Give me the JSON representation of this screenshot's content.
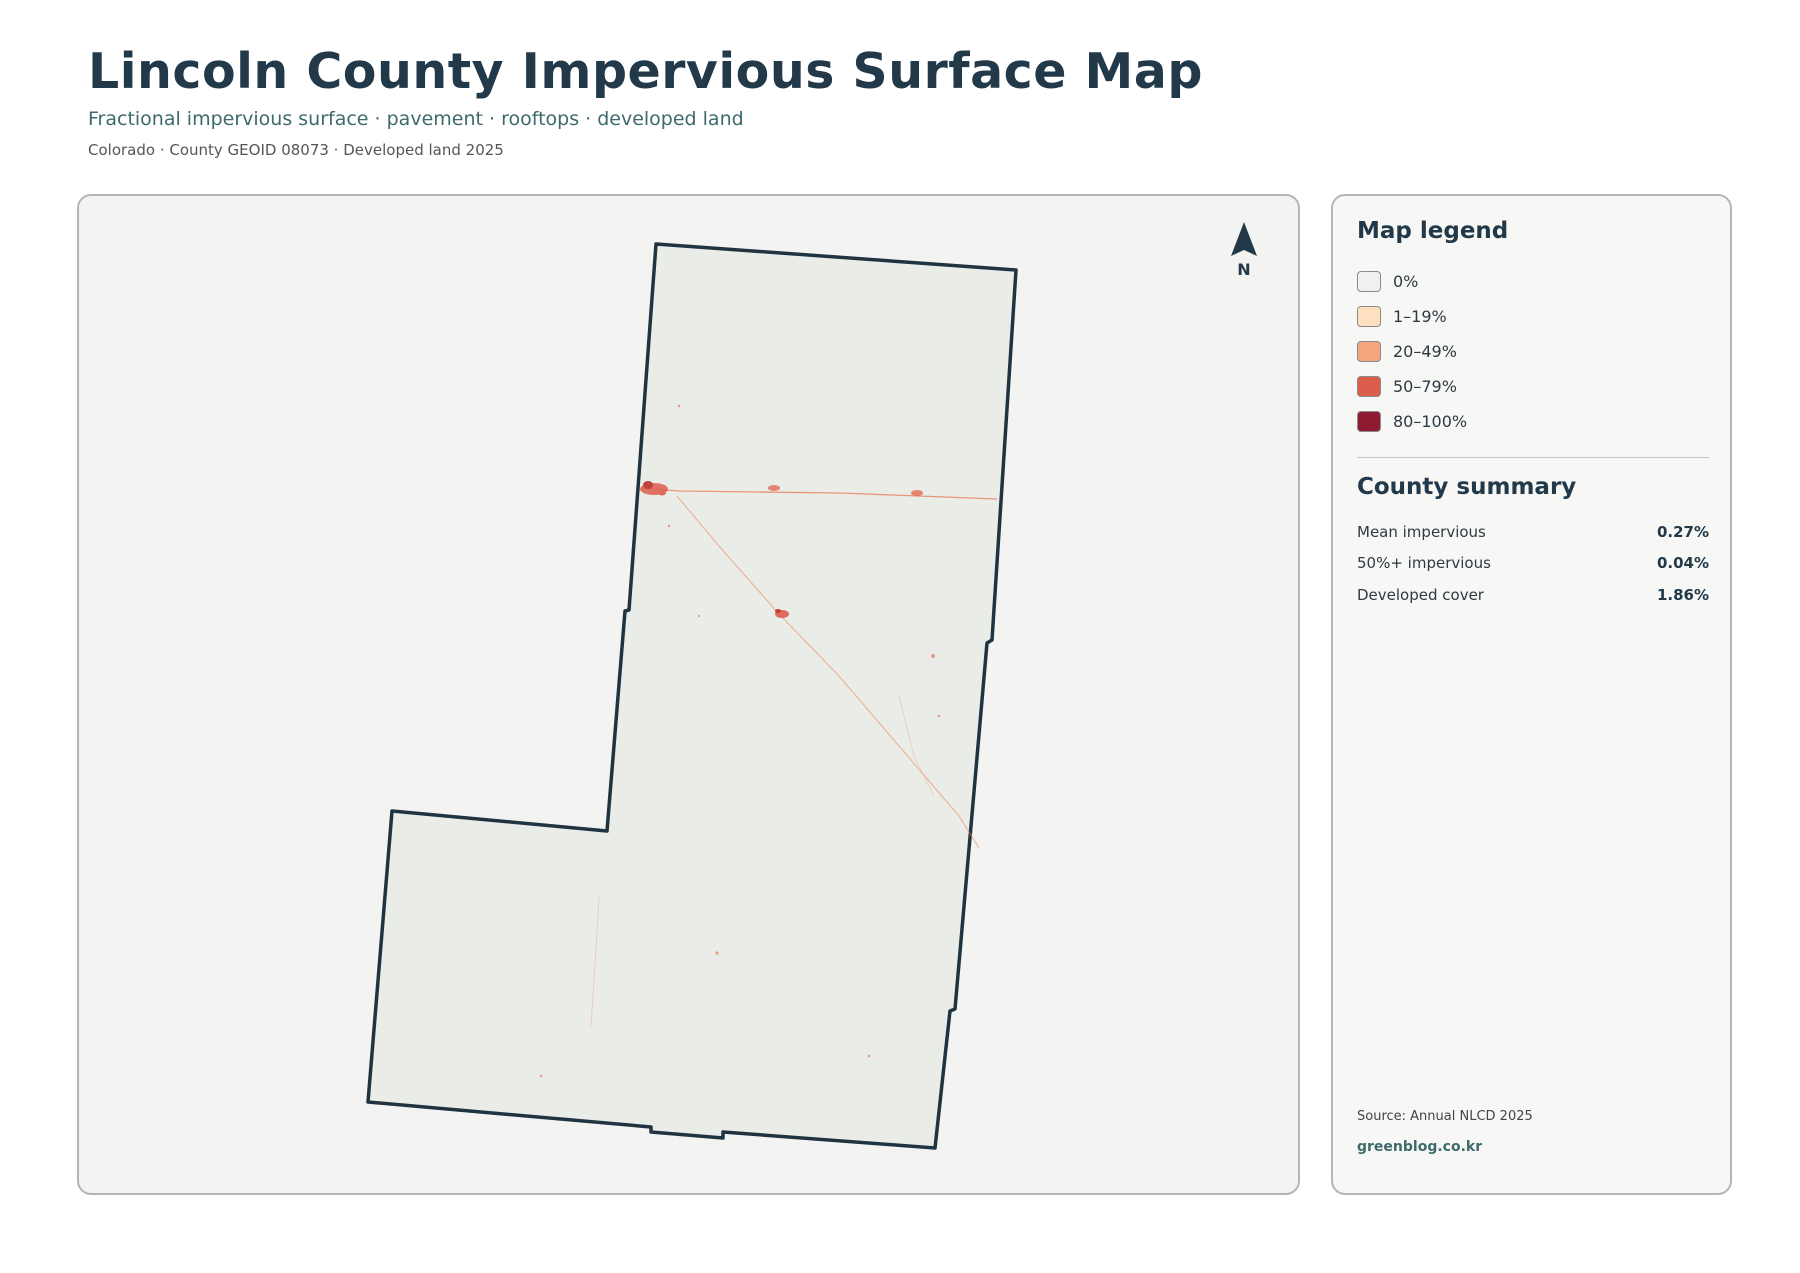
{
  "header": {
    "title": "Lincoln County Impervious Surface Map",
    "subtitle": "Fractional impervious surface · pavement · rooftops · developed land",
    "meta": "Colorado · County GEOID 08073 · Developed land 2025"
  },
  "map": {
    "north_label": "N",
    "county_fill": "#eaece7",
    "border_color": "#1f3440",
    "impervious_color": "#e0603f"
  },
  "legend": {
    "title": "Map legend",
    "items": [
      {
        "label": "0%",
        "color": "#f0f0ee"
      },
      {
        "label": "1–19%",
        "color": "#fde0c0"
      },
      {
        "label": "20–49%",
        "color": "#f4a67c"
      },
      {
        "label": "50–79%",
        "color": "#dd5d4c"
      },
      {
        "label": "80–100%",
        "color": "#8e1b32"
      }
    ]
  },
  "summary": {
    "title": "County summary",
    "rows": [
      {
        "label": "Mean impervious",
        "value": "0.27%"
      },
      {
        "label": "50%+ impervious",
        "value": "0.04%"
      },
      {
        "label": "Developed cover",
        "value": "1.86%"
      }
    ]
  },
  "footer": {
    "source": "Source: Annual NLCD 2025",
    "site": "greenblog.co.kr"
  }
}
